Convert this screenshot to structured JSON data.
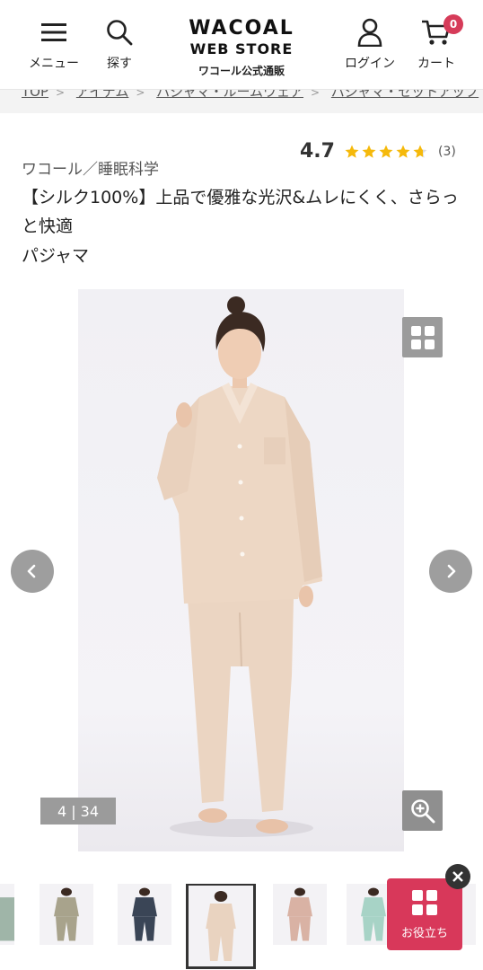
{
  "header": {
    "menu_label": "メニュー",
    "search_label": "探す",
    "logo_line1": "WACOAL",
    "logo_line2": "WEB STORE",
    "logo_line3": "ワコール公式通販",
    "login_label": "ログイン",
    "cart_label": "カート",
    "cart_count": "0"
  },
  "breadcrumb": {
    "items": [
      "TOP",
      "アイテム",
      "パジャマ・ルームウェア",
      "パジャマ・セットアップ"
    ]
  },
  "product": {
    "brand": "ワコール／睡眠科学",
    "rating": "4.7",
    "rating_value": 4.7,
    "review_count": "(3)",
    "title": "【シルク100%】上品で優雅な光沢&ムレにくく、さらっと快適",
    "subtitle": "パジャマ"
  },
  "gallery": {
    "counter": "4 | 34",
    "current_index": 4,
    "total": 34,
    "icons": [
      "grid-view-icon",
      "zoom-in-icon",
      "chevron-left-icon",
      "chevron-right-icon"
    ]
  },
  "thumbnails": [
    {
      "color": "#a8a38c",
      "selected": false
    },
    {
      "color": "#3a4556",
      "selected": false
    },
    {
      "color": "#e9d3c0",
      "selected": true
    },
    {
      "color": "#d9b2a4",
      "selected": false
    },
    {
      "color": "#a7d3c6",
      "selected": false
    },
    {
      "color": "#9aa89e",
      "selected": false
    }
  ],
  "floating": {
    "help_label": "お役立ち"
  },
  "colors": {
    "accent": "#d8385a",
    "star": "#f5b90b",
    "pajama": "#ecd6c4"
  }
}
